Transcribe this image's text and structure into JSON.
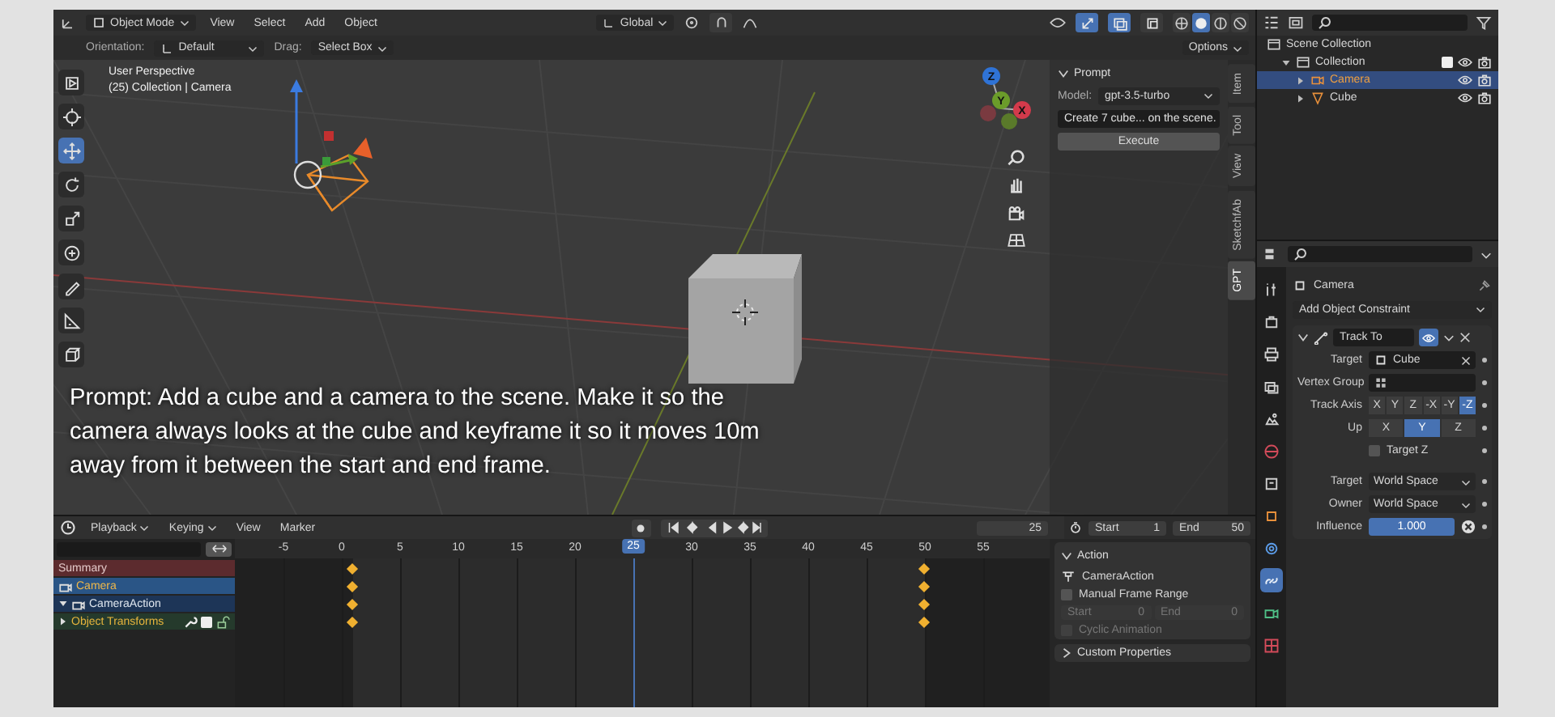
{
  "viewport_header": {
    "mode": "Object Mode",
    "menus": [
      "View",
      "Select",
      "Add",
      "Object"
    ],
    "transform_orientation": "Global",
    "toggles": [
      {
        "kind": "gizmos",
        "on": true
      },
      {
        "kind": "overlays",
        "on": true
      },
      {
        "kind": "xray",
        "on": false
      }
    ],
    "shading": [
      {
        "kind": "wireframe",
        "selected": false
      },
      {
        "kind": "solid",
        "selected": true
      },
      {
        "kind": "material",
        "selected": false
      },
      {
        "kind": "rendered",
        "selected": false
      }
    ]
  },
  "tool_settings": {
    "orientation_label": "Orientation:",
    "orientation": "Default",
    "drag_label": "Drag:",
    "drag": "Select Box",
    "options": "Options"
  },
  "toolbar": [
    {
      "kind": "select_box",
      "selected": false
    },
    {
      "kind": "cursor",
      "selected": false
    },
    {
      "kind": "move",
      "selected": true
    },
    {
      "kind": "rotate",
      "selected": false
    },
    {
      "kind": "scale",
      "selected": false
    },
    {
      "kind": "transform",
      "selected": false
    },
    {
      "kind": "annotate",
      "selected": false
    },
    {
      "kind": "measure",
      "selected": false
    },
    {
      "kind": "add_cube",
      "selected": false
    }
  ],
  "viewport": {
    "view_name": "User Perspective",
    "context": "(25) Collection | Camera",
    "gizmo_axes": [
      "Z",
      "Y",
      "X"
    ],
    "caption": "Prompt: Add a cube and a camera to the scene. Make it so the camera always looks at the cube and keyframe it so it moves 10m away from it between the start and end frame."
  },
  "sidebar": {
    "tabs": [
      {
        "label": "Item",
        "selected": false
      },
      {
        "label": "Tool",
        "selected": false
      },
      {
        "label": "View",
        "selected": false
      },
      {
        "label": "SketchfAb",
        "selected": false
      },
      {
        "label": "GPT",
        "selected": true
      }
    ],
    "panel": {
      "title": "Prompt",
      "expanded": true,
      "model_label": "Model:",
      "model": "gpt-3.5-turbo",
      "prompt": "Create 7 cube... on the scene.",
      "button": "Execute"
    }
  },
  "outliner": {
    "items": [
      {
        "label": "Scene Collection",
        "kind": "scene",
        "selected": false,
        "children": [
          {
            "label": "Collection",
            "kind": "collection",
            "expanded": true,
            "checked": true,
            "selected": false,
            "children": [
              {
                "label": "Camera",
                "kind": "camera",
                "expanded": false,
                "selected": true
              },
              {
                "label": "Cube",
                "kind": "mesh",
                "expanded": false,
                "selected": false
              }
            ]
          }
        ]
      }
    ]
  },
  "properties": {
    "tabs": [
      {
        "kind": "tool",
        "selected": false
      },
      {
        "kind": "render",
        "selected": false
      },
      {
        "kind": "output",
        "selected": false
      },
      {
        "kind": "view_layer",
        "selected": false
      },
      {
        "kind": "scene",
        "selected": false
      },
      {
        "kind": "world",
        "selected": false
      },
      {
        "kind": "collection",
        "selected": false
      },
      {
        "kind": "object",
        "selected": false
      },
      {
        "kind": "physics",
        "selected": false
      },
      {
        "kind": "constraint",
        "selected": true
      },
      {
        "kind": "camera_data",
        "selected": false
      },
      {
        "kind": "texture",
        "selected": false
      }
    ],
    "object": "Camera",
    "add_constraint": "Add Object Constraint",
    "constraint": {
      "name": "Track To",
      "expanded": true,
      "enabled": true,
      "fields": [
        {
          "kind": "object",
          "label": "Target",
          "value": "Cube"
        },
        {
          "kind": "vertex_group",
          "label": "Vertex Group"
        },
        {
          "kind": "options",
          "label": "Track Axis",
          "options": [
            {
              "label": "X",
              "selected": false
            },
            {
              "label": "Y",
              "selected": false
            },
            {
              "label": "Z",
              "selected": false
            },
            {
              "label": "-X",
              "selected": false
            },
            {
              "label": "-Y",
              "selected": false
            },
            {
              "label": "-Z",
              "selected": true
            }
          ]
        },
        {
          "kind": "options",
          "label": "Up",
          "options": [
            {
              "label": "X",
              "selected": false
            },
            {
              "label": "Y",
              "selected": true
            },
            {
              "label": "Z",
              "selected": false
            }
          ]
        },
        {
          "kind": "checkbox",
          "label": "Target Z",
          "checked": false
        },
        {
          "kind": "dropdown",
          "label": "Target",
          "value": "World Space"
        },
        {
          "kind": "dropdown",
          "label": "Owner",
          "value": "World Space"
        },
        {
          "kind": "slider",
          "label": "Influence",
          "value": "1.000",
          "level": 1
        }
      ]
    }
  },
  "timeline": {
    "menus": [
      "Playback",
      "Keying",
      "View",
      "Marker"
    ],
    "current_frame": "25",
    "start_label": "Start",
    "start": "1",
    "end_label": "End",
    "end": "50"
  },
  "dopesheet": {
    "ruler": [
      "-5",
      "0",
      "5",
      "10",
      "15",
      "20",
      "25",
      "30",
      "35",
      "40",
      "45",
      "50",
      "55"
    ],
    "channels": [
      {
        "label": "Summary",
        "kind": "summary"
      },
      {
        "label": "Camera",
        "kind": "object"
      },
      {
        "label": "CameraAction",
        "kind": "action",
        "expanded": true
      },
      {
        "label": "Object Transforms",
        "kind": "group",
        "expanded": false,
        "checked": true
      }
    ]
  },
  "action_panel": {
    "title": "Action",
    "action": "CameraAction",
    "manual_range": {
      "label": "Manual Frame Range",
      "checked": false
    },
    "start_label": "Start",
    "start": "0",
    "end_label": "End",
    "end": "0",
    "range_disabled": true,
    "cyclic": {
      "label": "Cyclic Animation",
      "checked": false,
      "disabled": true
    },
    "custom_properties": "Custom Properties"
  }
}
